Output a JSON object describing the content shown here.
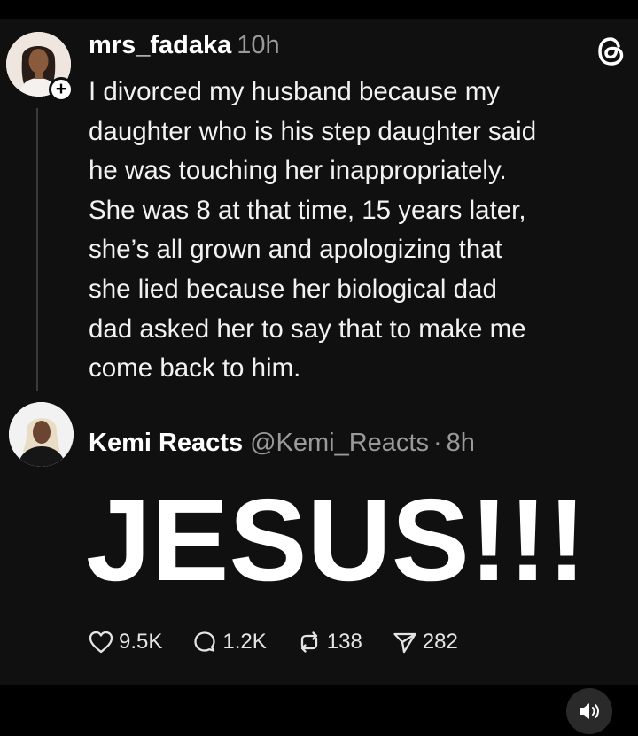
{
  "post": {
    "username": "mrs_fadaka",
    "time": "10h",
    "lines": [
      "I divorced my husband because my",
      "daughter who is his step daughter said",
      "he was touching her inappropriately.",
      "She was 8 at that time, 15 years later,",
      "she’s all grown and apologizing that",
      "she lied because her biological dad",
      "dad asked her to say that to make me",
      "come back to him."
    ]
  },
  "quote": {
    "name": "Kemi Reacts",
    "handle": "@Kemi_Reacts",
    "separator": "·",
    "time": "8h",
    "body": "JESUS!!!"
  },
  "actions": {
    "likes": "9.5K",
    "replies": "1.2K",
    "reposts": "138",
    "shares": "282"
  },
  "badge": {
    "plus": "+"
  },
  "icons": {
    "threads": "threads-logo-icon",
    "like": "heart-icon",
    "reply": "comment-bubble-icon",
    "repost": "repost-arrows-icon",
    "share": "send-paper-plane-icon",
    "sound": "speaker-icon"
  },
  "colors": {
    "background": "#101010",
    "text": "#ffffff",
    "muted": "#9a9a9a"
  }
}
